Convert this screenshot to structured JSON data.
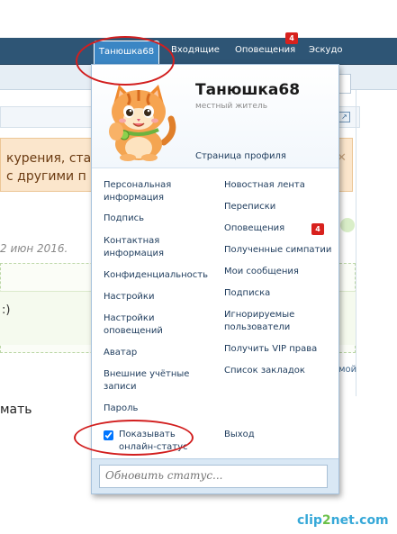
{
  "nav": {
    "tabs": [
      {
        "label": "Танюшка68",
        "active": true
      },
      {
        "label": "Входящие"
      },
      {
        "label": "Оповещения",
        "badge": "4"
      },
      {
        "label": "Эскудо"
      }
    ]
  },
  "background": {
    "warning_line1": "курения, ста",
    "warning_line2": "с другими п",
    "date_fragment": "2 июн 2016.",
    "smile": ":)",
    "right_fragment": "мой",
    "bottom_fragment": "мать",
    "watermark": {
      "part1": "clip",
      "part2": "2",
      "part3": "net.com"
    }
  },
  "profile": {
    "username": "Танюшка68",
    "title": "местный житель",
    "profile_link": "Страница профиля"
  },
  "menu_left": [
    "Персональная\nинформация",
    "Подпись",
    "Контактная\nинформация",
    "Конфиденциальность",
    "Настройки",
    "Настройки\nоповещений",
    "Аватар",
    "Внешние учётные\nзаписи",
    "Пароль"
  ],
  "menu_right": [
    "Новостная лента",
    "Переписки",
    "Оповещения",
    "Полученные симпатии",
    "Мои сообщения",
    "Подписка",
    "Игнорируемые\nпользователи",
    "Получить VIP права",
    "Список закладок"
  ],
  "alerts_badge": "4",
  "online_status": {
    "label": "Показывать\nонлайн-статус",
    "checked": true
  },
  "logout": "Выход",
  "status": {
    "placeholder": "Обновить статус..."
  },
  "colors": {
    "navbar": "#2e5575",
    "active_tab": "#3b86c4",
    "badge": "#d8211d",
    "annotation": "#d21f1f"
  }
}
